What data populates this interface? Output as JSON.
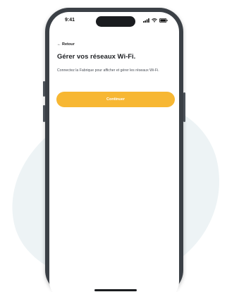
{
  "status_bar": {
    "time": "9:41"
  },
  "header": {
    "back_label": "← Retour"
  },
  "main": {
    "title": "Gérer vos réseaux Wi-Fi.",
    "description": "Connectez la Fabrique pour afficher et gérer les réseaux Wi-Fi.",
    "continue_label": "Continuer"
  },
  "colors": {
    "accent": "#f7b733",
    "phone_frame": "#3b4046",
    "background_blob": "#edf3f5"
  }
}
